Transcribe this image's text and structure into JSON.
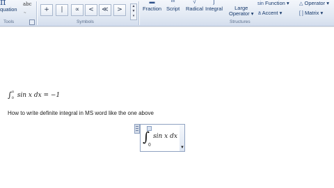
{
  "ribbon": {
    "equation_label": "quation",
    "abc_label": "abc",
    "groups": {
      "tools": "Tools",
      "symbols": "Symbols",
      "structures": "Structures"
    },
    "symbols": [
      "±",
      "∞",
      "=",
      "≠",
      "∼",
      "×",
      "÷",
      "!",
      "∝",
      "<",
      "≪",
      ">"
    ],
    "visible_symbols": [
      "+",
      "∣",
      "∝",
      "<",
      "≪",
      ">"
    ],
    "structures": [
      {
        "label": "Fraction",
        "icon": "fraction-icon"
      },
      {
        "label": "Script",
        "icon": "script-icon"
      },
      {
        "label": "Radical",
        "icon": "radical-icon"
      },
      {
        "label": "Integral",
        "icon": "integral-icon"
      },
      {
        "label": "Large Operator",
        "line1": "Large",
        "line2": "Operator"
      }
    ],
    "menus": [
      {
        "label": "Function",
        "icon": "sin-icon",
        "prefix": "sin θ"
      },
      {
        "label": "Accent",
        "prefix": "ä"
      },
      {
        "label": "Operator",
        "prefix": "△"
      },
      {
        "label": "Matrix",
        "prefix": "[]"
      }
    ]
  },
  "document": {
    "formula": {
      "upper": "π",
      "lower": "0",
      "body": "sin x dx",
      "result": " = −1"
    },
    "question": "How to write definite integral in MS word like the one above",
    "equation_box": {
      "lower": "0",
      "body": "sin x dx"
    }
  }
}
